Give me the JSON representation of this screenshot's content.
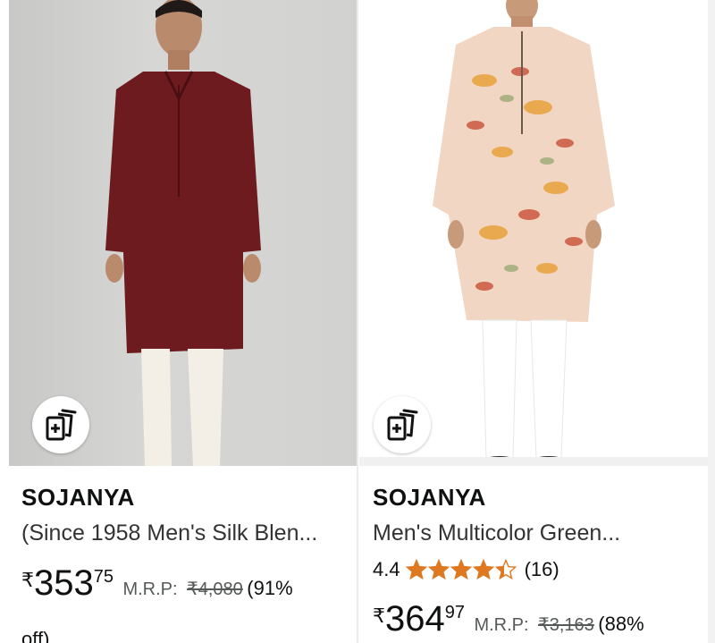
{
  "products": [
    {
      "brand": "SOJANYA",
      "title": "(Since 1958 Men's Silk Blen...",
      "price_currency": "₹",
      "price_whole": "353",
      "price_fraction": "75",
      "mrp_label": "M.R.P:",
      "mrp_value": "₹4,080",
      "discount": "(91%",
      "discount_cont": "off)",
      "image_colors": {
        "kurta": "#6e1b1f",
        "pants": "#f4efe6"
      }
    },
    {
      "brand": "SOJANYA",
      "title": "Men's Multicolor Green...",
      "rating_value": "4.4",
      "rating_stars": 4.4,
      "rating_count": "(16)",
      "price_currency": "₹",
      "price_whole": "364",
      "price_fraction": "97",
      "mrp_label": "M.R.P:",
      "mrp_value": "₹3,163",
      "discount": "(88%",
      "image_colors": {
        "kurta": "#f1d6c4",
        "pants": "#ffffff"
      }
    }
  ],
  "colors": {
    "star": "#de7921",
    "accent": "#0f1111"
  }
}
